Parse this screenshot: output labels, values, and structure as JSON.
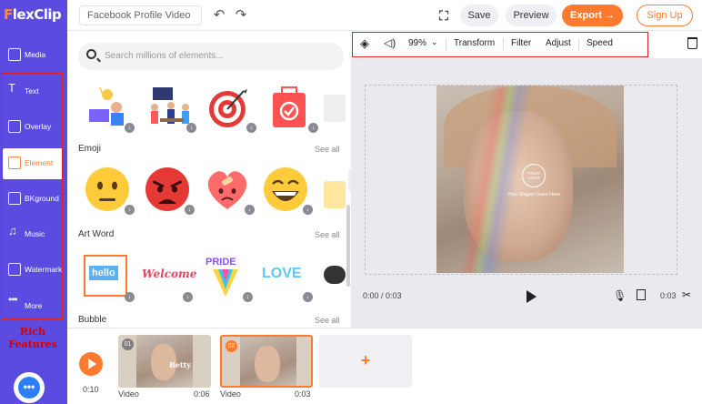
{
  "header": {
    "logo": "FlexClip",
    "project_name": "Facebook Profile Video",
    "save_label": "Save",
    "preview_label": "Preview",
    "export_label": "Export →",
    "signup_label": "Sign Up"
  },
  "sidebar": {
    "items": [
      {
        "label": "Media",
        "icon": "media-icon"
      },
      {
        "label": "Text",
        "icon": "text-icon"
      },
      {
        "label": "Overlay",
        "icon": "overlay-icon"
      },
      {
        "label": "Element",
        "icon": "element-icon"
      },
      {
        "label": "BKground",
        "icon": "background-icon"
      },
      {
        "label": "Music",
        "icon": "music-icon"
      },
      {
        "label": "Watermark",
        "icon": "watermark-icon"
      },
      {
        "label": "More",
        "icon": "more-icon"
      }
    ],
    "active": "Element",
    "annotation": "Rich Features"
  },
  "panel": {
    "search_placeholder": "Search millions of elements...",
    "sections": [
      {
        "title": "Emoji",
        "see_all": "See all"
      },
      {
        "title": "Art Word",
        "see_all": "See all"
      },
      {
        "title": "Bubble",
        "see_all": "See all"
      }
    ],
    "art_words": [
      "hello",
      "Welcome",
      "PRIDE",
      "LOVE"
    ]
  },
  "toolbar": {
    "volume": "99%",
    "transform": "Transform",
    "filter": "Filter",
    "adjust": "Adjust",
    "speed": "Speed"
  },
  "canvas": {
    "logo_text": "YOUR LOGO",
    "slogan": "Your Slogan Goes Here",
    "time_current": "0:00 / 0:03",
    "time_total": "0:03"
  },
  "timeline": {
    "total_time": "0:10",
    "clips": [
      {
        "num": "01",
        "label": "Video",
        "duration": "0:06",
        "overlay_text": "Betty"
      },
      {
        "num": "02",
        "label": "Video",
        "duration": "0:03"
      }
    ]
  },
  "colors": {
    "brand": "#5b4be0",
    "accent": "#ff7a2e",
    "highlight": "#e02020"
  }
}
